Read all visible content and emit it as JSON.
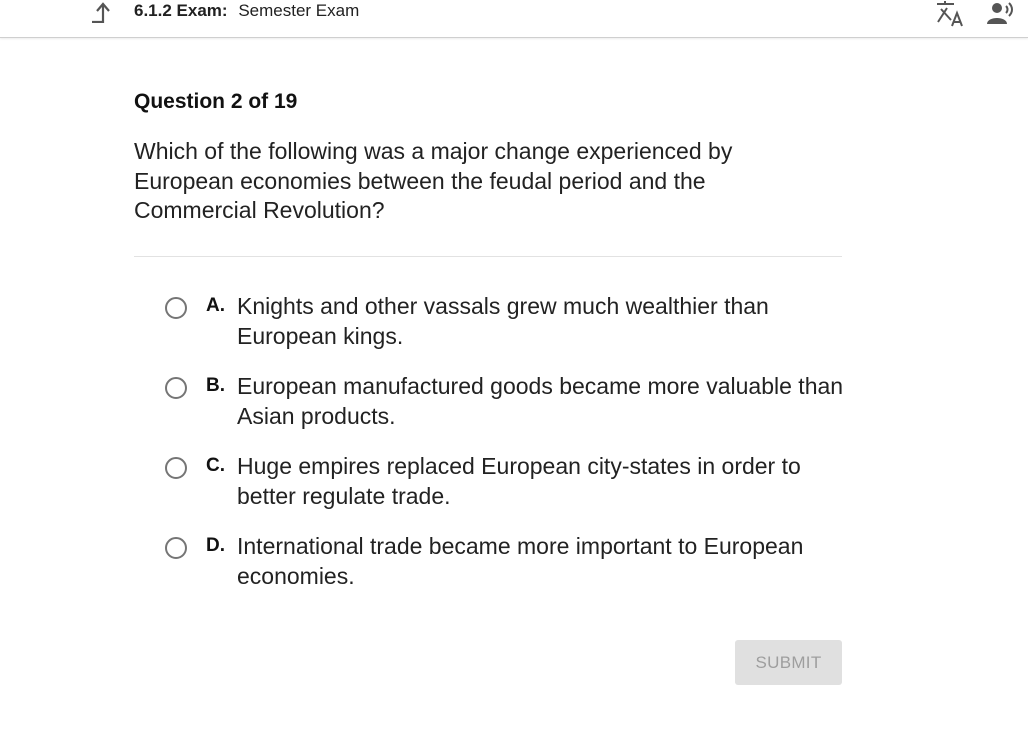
{
  "header": {
    "code": "6.1.2",
    "type": "Exam:",
    "title": "Semester Exam",
    "icons": {
      "back": "back-arrow-icon",
      "translate": "translate-icon",
      "audio": "read-aloud-icon"
    }
  },
  "question": {
    "counter": "Question 2 of 19",
    "text": "Which of the following was a major change experienced by European economies between the feudal period and the Commercial Revolution?"
  },
  "options": [
    {
      "letter": "A.",
      "text": "Knights and other vassals grew much wealthier than European kings."
    },
    {
      "letter": "B.",
      "text": "European manufactured goods became more valuable than Asian products."
    },
    {
      "letter": "C.",
      "text": "Huge empires replaced European city-states in order to better regulate trade."
    },
    {
      "letter": "D.",
      "text": "International trade became more important to European economies."
    }
  ],
  "submit_label": "SUBMIT",
  "colors": {
    "radio_border": "#757575",
    "submit_bg": "#e0e0e0",
    "submit_text": "#9e9e9e"
  }
}
